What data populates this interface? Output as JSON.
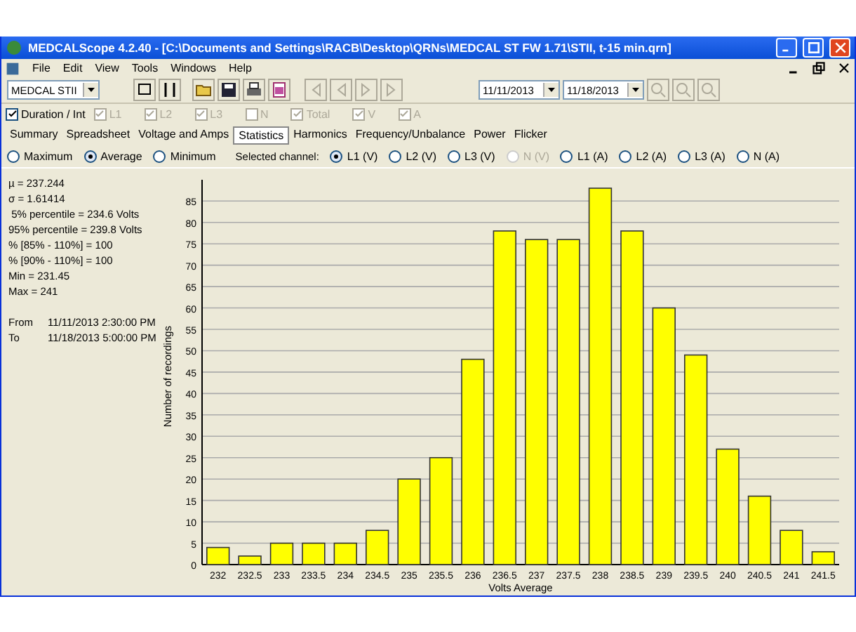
{
  "window": {
    "title": "MEDCALScope 4.2.40  - [C:\\Documents and Settings\\RACB\\Desktop\\QRNs\\MEDCAL ST FW  1.71\\STII, t-15 min.qrn]"
  },
  "menu": [
    "File",
    "Edit",
    "View",
    "Tools",
    "Windows",
    "Help"
  ],
  "toolbar": {
    "device": "MEDCAL STII",
    "date_from": "11/11/2013",
    "date_to": "11/18/2013"
  },
  "filters": [
    {
      "label": "Duration / Int",
      "checked": true,
      "disabled": false
    },
    {
      "label": "L1",
      "checked": true,
      "disabled": true
    },
    {
      "label": "L2",
      "checked": true,
      "disabled": true
    },
    {
      "label": "L3",
      "checked": true,
      "disabled": true
    },
    {
      "label": "N",
      "checked": false,
      "disabled": true
    },
    {
      "label": "Total",
      "checked": true,
      "disabled": true
    },
    {
      "label": "V",
      "checked": true,
      "disabled": true
    },
    {
      "label": "A",
      "checked": true,
      "disabled": true
    }
  ],
  "tabs": [
    {
      "label": "Summary",
      "selected": false
    },
    {
      "label": "Spreadsheet",
      "selected": false
    },
    {
      "label": "Voltage and Amps",
      "selected": false
    },
    {
      "label": "Statistics",
      "selected": true
    },
    {
      "label": "Harmonics",
      "selected": false
    },
    {
      "label": "Frequency/Unbalance",
      "selected": false
    },
    {
      "label": "Power",
      "selected": false
    },
    {
      "label": "Flicker",
      "selected": false
    }
  ],
  "modes": [
    {
      "label": "Maximum",
      "selected": false
    },
    {
      "label": "Average",
      "selected": true
    },
    {
      "label": "Minimum",
      "selected": false
    }
  ],
  "channel_label": "Selected channel:",
  "channels": [
    {
      "label": "L1 (V)",
      "selected": true,
      "disabled": false
    },
    {
      "label": "L2 (V)",
      "selected": false,
      "disabled": false
    },
    {
      "label": "L3 (V)",
      "selected": false,
      "disabled": false
    },
    {
      "label": "N (V)",
      "selected": false,
      "disabled": true
    },
    {
      "label": "L1 (A)",
      "selected": false,
      "disabled": false
    },
    {
      "label": "L2 (A)",
      "selected": false,
      "disabled": false
    },
    {
      "label": "L3 (A)",
      "selected": false,
      "disabled": false
    },
    {
      "label": "N (A)",
      "selected": false,
      "disabled": false
    }
  ],
  "stats": [
    "µ = 237.244",
    "σ = 1.61414",
    " 5% percentile = 234.6 Volts",
    "95% percentile = 239.8 Volts",
    "% [85% - 110%] = 100",
    "% [90% - 110%] = 100",
    "Min = 231.45",
    "Max = 241"
  ],
  "range": [
    {
      "label": "From",
      "value": "11/11/2013 2:30:00 PM"
    },
    {
      "label": "To",
      "value": "11/18/2013 5:00:00 PM"
    }
  ],
  "chart_data": {
    "type": "bar",
    "xlabel": "Volts Average",
    "ylabel": "Number of recordings",
    "grid": true,
    "categories": [
      "232",
      "232.5",
      "233",
      "233.5",
      "234",
      "234.5",
      "235",
      "235.5",
      "236",
      "236.5",
      "237",
      "237.5",
      "238",
      "238.5",
      "239",
      "239.5",
      "240",
      "240.5",
      "241",
      "241.5"
    ],
    "values": [
      4,
      2,
      5,
      5,
      5,
      8,
      20,
      25,
      48,
      78,
      76,
      76,
      88,
      78,
      60,
      49,
      27,
      16,
      8,
      3
    ],
    "ylim": [
      0,
      88
    ],
    "yticks": [
      0,
      5,
      10,
      15,
      20,
      25,
      30,
      35,
      40,
      45,
      50,
      55,
      60,
      65,
      70,
      75,
      80,
      85
    ]
  }
}
